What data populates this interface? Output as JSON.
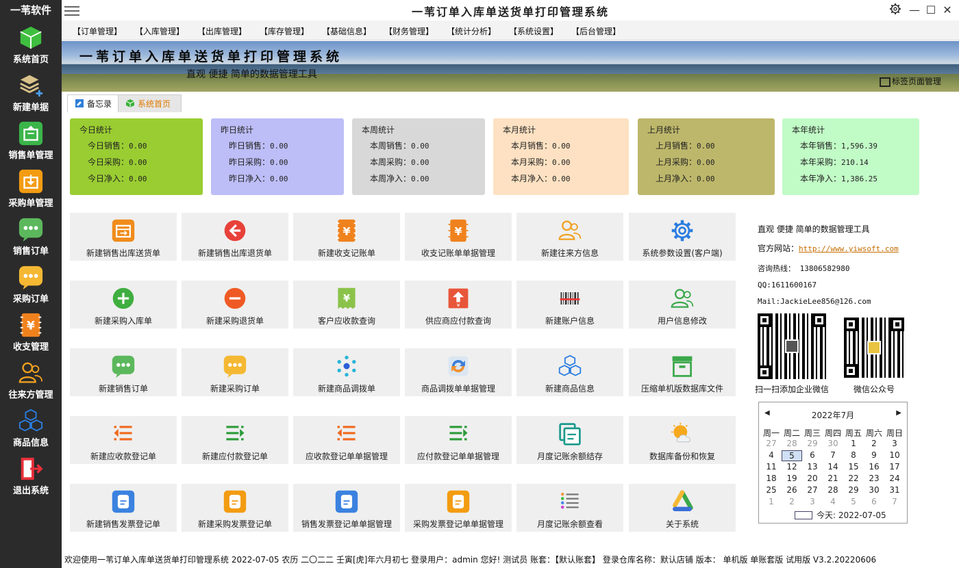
{
  "brand": "一苇软件",
  "window": {
    "title": "一苇订单入库单送货单打印管理系统",
    "settings_icon": "gear-icon",
    "minimize": "—",
    "maximize": "☐",
    "close": "✕"
  },
  "sidebar": {
    "items": [
      {
        "label": "系统首页",
        "icon": "green-cube-icon"
      },
      {
        "label": "新建单据",
        "icon": "stack-add-icon"
      },
      {
        "label": "销售单管理",
        "icon": "green-box-out-icon"
      },
      {
        "label": "采购单管理",
        "icon": "orange-box-in-icon"
      },
      {
        "label": "销售订单",
        "icon": "green-chat-icon"
      },
      {
        "label": "采购订单",
        "icon": "yellow-chat-icon"
      },
      {
        "label": "收支管理",
        "icon": "yen-icon"
      },
      {
        "label": "往来方管理",
        "icon": "contacts-icon"
      },
      {
        "label": "商品信息",
        "icon": "blue-cubes-icon"
      },
      {
        "label": "退出系统",
        "icon": "exit-icon"
      }
    ]
  },
  "menu": [
    "【订单管理】",
    "【入库管理】",
    "【出库管理】",
    "【库存管理】",
    "【基础信息】",
    "【财务管理】",
    "【统计分析】",
    "【系统设置】",
    "【后台管理】"
  ],
  "banner": {
    "title": "一苇订单入库单送货单打印管理系统",
    "subtitle": "直观 便捷 简单的数据管理工具",
    "tab_manager": "标签页面管理"
  },
  "tabs": [
    {
      "label": "备忘录",
      "icon": "memo-icon"
    },
    {
      "label": "系统首页",
      "icon": "green-cube-icon",
      "active": true
    }
  ],
  "stats": [
    {
      "title": "今日统计",
      "color": "#9acd32",
      "rows": [
        {
          "label": "今日销售：",
          "value": "0.00"
        },
        {
          "label": "今日采购：",
          "value": "0.00"
        },
        {
          "label": "今日净入：",
          "value": "0.00"
        }
      ]
    },
    {
      "title": "昨日统计",
      "color": "#bdbdf7",
      "rows": [
        {
          "label": "昨日销售：",
          "value": "0.00"
        },
        {
          "label": "昨日采购：",
          "value": "0.00"
        },
        {
          "label": "昨日净入：",
          "value": "0.00"
        }
      ]
    },
    {
      "title": "本周统计",
      "color": "#d8d8d8",
      "rows": [
        {
          "label": "本周销售：",
          "value": "0.00"
        },
        {
          "label": "本周采购：",
          "value": "0.00"
        },
        {
          "label": "本周净入：",
          "value": "0.00"
        }
      ]
    },
    {
      "title": "本月统计",
      "color": "#fde1c2",
      "rows": [
        {
          "label": "本月销售：",
          "value": "0.00"
        },
        {
          "label": "本月采购：",
          "value": "0.00"
        },
        {
          "label": "本月净入：",
          "value": "0.00"
        }
      ]
    },
    {
      "title": "上月统计",
      "color": "#bdb76b",
      "rows": [
        {
          "label": "上月销售：",
          "value": "0.00"
        },
        {
          "label": "上月采购：",
          "value": "0.00"
        },
        {
          "label": "上月净入：",
          "value": "0.00"
        }
      ]
    },
    {
      "title": "本年统计",
      "color": "#c1fbc6",
      "rows": [
        {
          "label": "本年销售：",
          "value": "1,596.39"
        },
        {
          "label": "本年采购：",
          "value": "210.14"
        },
        {
          "label": "本年净入：",
          "value": "1,386.25"
        }
      ]
    }
  ],
  "tiles": [
    [
      {
        "label": "新建销售出库送货单",
        "icon": "orange-box-out-icon"
      },
      {
        "label": "新建销售出库退货单",
        "icon": "red-arrow-left-icon"
      },
      {
        "label": "新建收支记账单",
        "icon": "yen-icon"
      },
      {
        "label": "收支记账单单据管理",
        "icon": "yen-doc-icon"
      },
      {
        "label": "新建往来方信息",
        "icon": "contacts-icon"
      },
      {
        "label": "系统参数设置(客户端)",
        "icon": "gear-icon"
      }
    ],
    [
      {
        "label": "新建采购入库单",
        "icon": "green-plus-icon"
      },
      {
        "label": "新建采购退货单",
        "icon": "orange-minus-icon"
      },
      {
        "label": "客户应收款查询",
        "icon": "green-receipt-icon"
      },
      {
        "label": "供应商应付款查询",
        "icon": "red-upload-icon"
      },
      {
        "label": "新建账户信息",
        "icon": "barcode-icon"
      },
      {
        "label": "用户信息修改",
        "icon": "users-icon"
      }
    ],
    [
      {
        "label": "新建销售订单",
        "icon": "green-chat-icon"
      },
      {
        "label": "新建采购订单",
        "icon": "yellow-chat-icon"
      },
      {
        "label": "新建商品调拨单",
        "icon": "network-icon"
      },
      {
        "label": "商品调拨单单据管理",
        "icon": "sync-icon"
      },
      {
        "label": "新建商品信息",
        "icon": "blue-cubes-icon"
      },
      {
        "label": "压缩单机版数据库文件",
        "icon": "archive-icon"
      }
    ],
    [
      {
        "label": "新建应收款登记单",
        "icon": "orange-list-in-icon"
      },
      {
        "label": "新建应付款登记单",
        "icon": "green-list-out-icon"
      },
      {
        "label": "应收款登记单单据管理",
        "icon": "orange-list-in-icon"
      },
      {
        "label": "应付款登记单单据管理",
        "icon": "green-list-out-icon"
      },
      {
        "label": "月度记账余额结存",
        "icon": "teal-copy-icon"
      },
      {
        "label": "数据库备份和恢复",
        "icon": "weather-icon"
      }
    ],
    [
      {
        "label": "新建销售发票登记单",
        "icon": "blue-invoice-icon"
      },
      {
        "label": "新建采购发票登记单",
        "icon": "orange-invoice-icon"
      },
      {
        "label": "销售发票登记单单据管理",
        "icon": "blue-invoice-icon"
      },
      {
        "label": "采购发票登记单单据管理",
        "icon": "orange-invoice-icon"
      },
      {
        "label": "月度记账余额查看",
        "icon": "checklist-icon"
      },
      {
        "label": "关于系统",
        "icon": "triangle-logo-icon"
      }
    ]
  ],
  "info": {
    "tagline": "直观 便捷 简单的数据管理工具",
    "website_label": "官方网站：",
    "website": "http://www.yiwsoft.com",
    "hotline": "咨询热线： 13806582980",
    "qq": "QQ:1611600167",
    "mail": "Mail:JackieLee856@126.com",
    "qr1_caption": "扫一扫添加企业微信",
    "qr2_caption": "微信公众号"
  },
  "calendar": {
    "month_label": "2022年7月",
    "prev": "◀",
    "next": "▶",
    "weekdays": [
      "周一",
      "周二",
      "周三",
      "周四",
      "周五",
      "周六",
      "周日"
    ],
    "weeks": [
      [
        "27",
        "28",
        "29",
        "30",
        "1",
        "2",
        "3"
      ],
      [
        "4",
        "5",
        "6",
        "7",
        "8",
        "9",
        "10"
      ],
      [
        "11",
        "12",
        "13",
        "14",
        "15",
        "16",
        "17"
      ],
      [
        "18",
        "19",
        "20",
        "21",
        "22",
        "23",
        "24"
      ],
      [
        "25",
        "26",
        "27",
        "28",
        "29",
        "30",
        "31"
      ],
      [
        "1",
        "2",
        "3",
        "4",
        "5",
        "6",
        "7"
      ]
    ],
    "selected_day": "5",
    "today_label": "今天: 2022-07-05"
  },
  "status": "欢迎使用一苇订单入库单送货单打印管理系统 2022-07-05 农历 二〇二二 壬寅[虎]年六月初七 登录用户：admin 您好! 测试员 账套：【默认账套】 登录仓库名称：默认店铺 版本： 单机版 单账套版 试用版 V3.2.20220606"
}
